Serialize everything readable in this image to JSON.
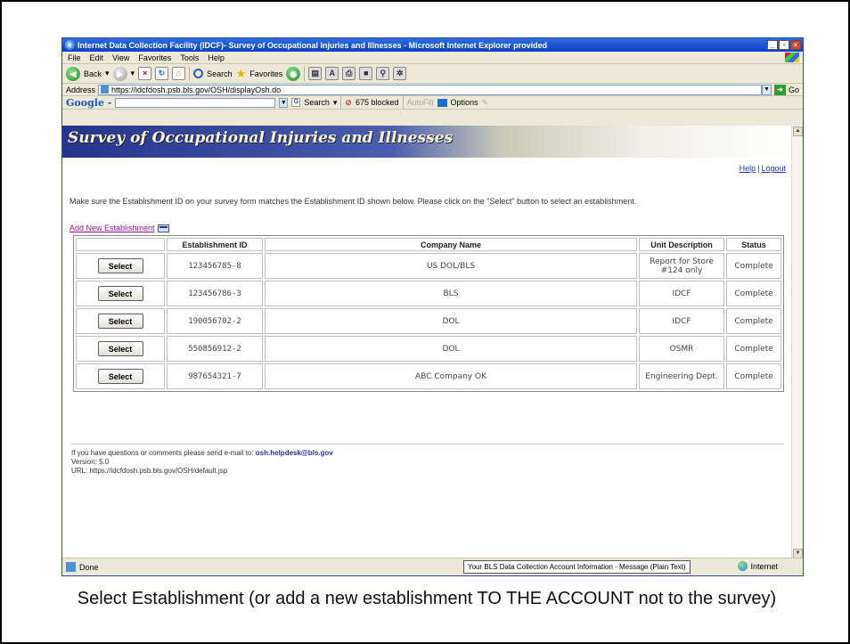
{
  "window": {
    "title": "Internet Data Collection Facility (IDCF)- Survey of Occupational Injuries and Illnesses - Microsoft Internet Explorer provided"
  },
  "menu": [
    "File",
    "Edit",
    "View",
    "Favorites",
    "Tools",
    "Help"
  ],
  "toolbar": {
    "back": "Back",
    "search": "Search",
    "favorites": "Favorites"
  },
  "address": {
    "label": "Address",
    "url": "https://idcfdosh.psb.bls.gov/OSH/displayOsh.do",
    "go": "Go"
  },
  "google": {
    "logo": "Google -",
    "search": "Search",
    "blocked": "675 blocked",
    "autofill": "AutoFill",
    "options": "Options"
  },
  "page": {
    "banner_title": "Survey of Occupational Injuries and Illnesses",
    "help": "Help",
    "logout": "Logout",
    "instructions": "Make sure the Establishment ID on your survey form matches the Establishment ID shown below. Please click on the \"Select\" button to select an establishment.",
    "add_new": "Add New Establishment"
  },
  "table": {
    "headers": [
      "Establishment ID",
      "Company Name",
      "Unit Description",
      "Status"
    ],
    "select_label": "Select",
    "rows": [
      {
        "id": "123456785-8",
        "company": "US DOL/BLS",
        "unit": "Report for Store #124 only",
        "status": "Complete"
      },
      {
        "id": "123456786-3",
        "company": "BLS",
        "unit": "IDCF",
        "status": "Complete"
      },
      {
        "id": "190056702-2",
        "company": "DOL",
        "unit": "IDCF",
        "status": "Complete"
      },
      {
        "id": "550856912-2",
        "company": "DOL",
        "unit": "OSMR",
        "status": "Complete"
      },
      {
        "id": "987654321-7",
        "company": "ABC Company OK",
        "unit": "Engineering Dept.",
        "status": "Complete"
      }
    ]
  },
  "footer": {
    "questions": "If you have questions or comments please send e-mail to:",
    "email": "osh.helpdesk@bls.gov",
    "version": "Version: 5.0",
    "url": "URL: https://idcfdosh.psb.bls.gov/OSH/default.jsp"
  },
  "status": {
    "done": "Done",
    "tooltip": "Your BLS Data Collection Account Information - Message (Plain Text)",
    "zone": "Internet"
  },
  "caption": "Select Establishment (or add a new establishment TO THE ACCOUNT not to the survey)"
}
